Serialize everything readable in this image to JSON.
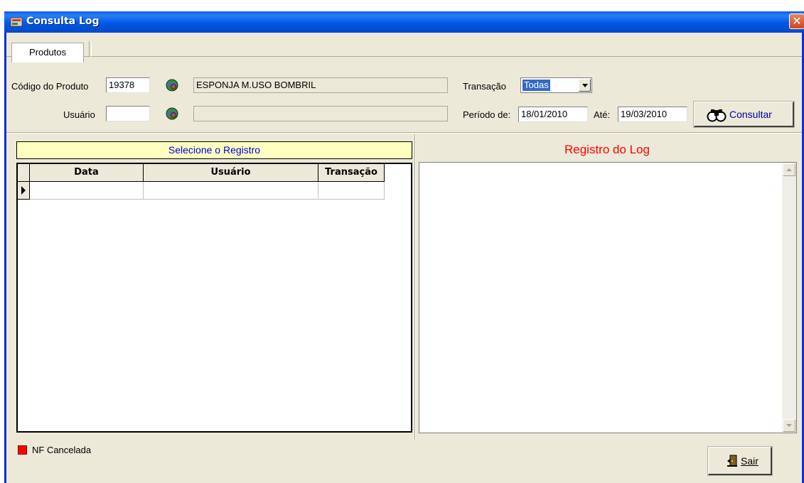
{
  "window": {
    "title": "Consulta Log",
    "close_glyph": "✕"
  },
  "tabs": [
    {
      "label": "Produtos"
    }
  ],
  "form": {
    "codigo_label": "Código do Produto",
    "codigo_value": "19378",
    "produto_desc": "ESPONJA M.USO BOMBRIL",
    "usuario_label": "Usuário",
    "usuario_value": "",
    "usuario_desc": "",
    "transacao_label": "Transação",
    "transacao_value": "Todas",
    "periodo_label": "Período de:",
    "periodo_de": "18/01/2010",
    "ate_label": "Até:",
    "periodo_ate": "19/03/2010",
    "consultar_label": "Consultar"
  },
  "registros": {
    "header": "Selecione o Registro",
    "columns": [
      "Data",
      "Usuário",
      "Transação"
    ],
    "rows": []
  },
  "log": {
    "title": "Registro do Log",
    "content": ""
  },
  "legend": {
    "label": "NF Cancelada",
    "color": "#ff0000"
  },
  "footer": {
    "sair_label": "Sair"
  },
  "icons": {
    "app": "app-icon",
    "search": "globe-search-icon",
    "binoculars": "binoculars-icon",
    "exit": "exit-door-icon"
  }
}
